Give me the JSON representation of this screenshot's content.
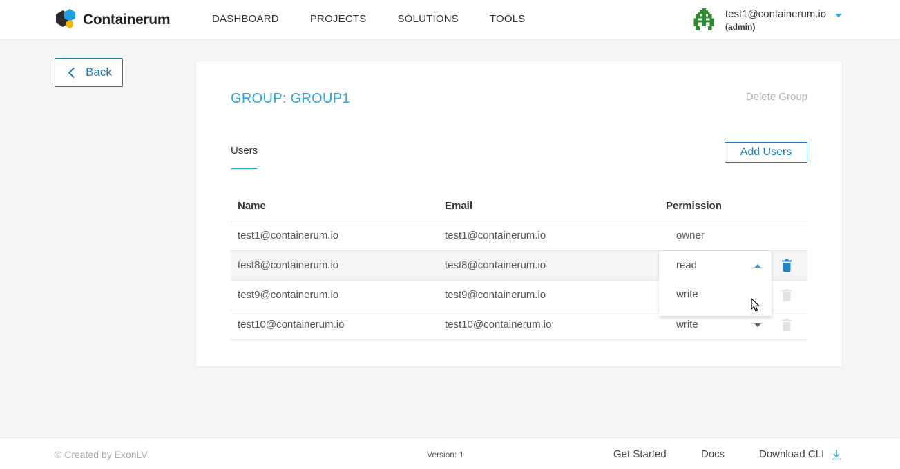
{
  "header": {
    "logo_text": "Containerum",
    "nav": [
      "DASHBOARD",
      "PROJECTS",
      "SOLUTIONS",
      "TOOLS"
    ],
    "user_email": "test1@containerum.io",
    "user_role": "(admin)"
  },
  "back_label": "Back",
  "group": {
    "title": "GROUP: GROUP1",
    "delete_label": "Delete Group",
    "tab_label": "Users",
    "add_users_label": "Add Users"
  },
  "table": {
    "headers": [
      "Name",
      "Email",
      "Permission"
    ],
    "rows": [
      {
        "name": "test1@containerum.io",
        "email": "test1@containerum.io",
        "permission": "owner"
      },
      {
        "name": "test8@containerum.io",
        "email": "test8@containerum.io",
        "permission": "read"
      },
      {
        "name": "test9@containerum.io",
        "email": "test9@containerum.io",
        "permission": ""
      },
      {
        "name": "test10@containerum.io",
        "email": "test10@containerum.io",
        "permission": "write"
      }
    ],
    "dropdown_option": "write"
  },
  "footer": {
    "copyright": "© Created by ExonLV",
    "version": "Version: 1",
    "links": [
      "Get Started",
      "Docs",
      "Download CLI"
    ]
  },
  "colors": {
    "accent": "#2aa5d6",
    "button_border": "#1a7ab8",
    "trash_active": "#1a87c9",
    "trash_disabled": "#e2e2e2"
  }
}
